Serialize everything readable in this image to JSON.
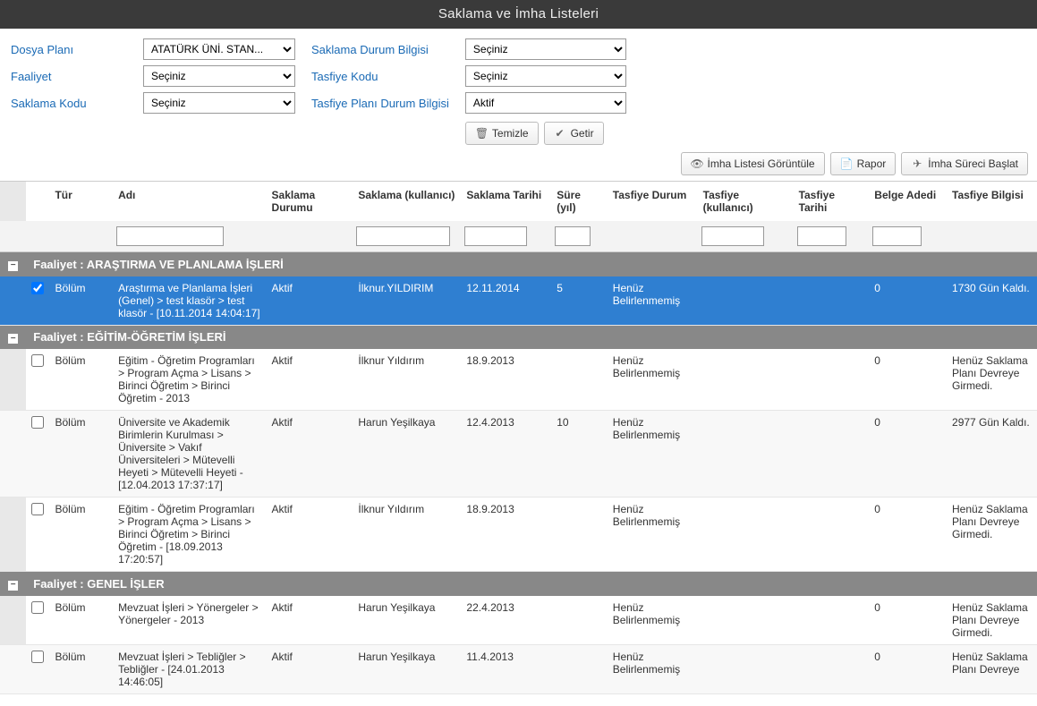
{
  "title": "Saklama ve İmha Listeleri",
  "filters": {
    "dosyaPlani": {
      "label": "Dosya Planı",
      "selected": "ATATÜRK ÜNİ. STAN..."
    },
    "faaliyet": {
      "label": "Faaliyet",
      "selected": "Seçiniz"
    },
    "saklamaKodu": {
      "label": "Saklama Kodu",
      "selected": "Seçiniz"
    },
    "saklamaDurum": {
      "label": "Saklama Durum Bilgisi",
      "selected": "Seçiniz"
    },
    "tasfiyeKodu": {
      "label": "Tasfiye Kodu",
      "selected": "Seçiniz"
    },
    "tasfiyePlanDurum": {
      "label": "Tasfiye Planı Durum Bilgisi",
      "selected": "Aktif"
    },
    "temizle": "Temizle",
    "getir": "Getir"
  },
  "actions": {
    "view": "İmha Listesi Görüntüle",
    "rapor": "Rapor",
    "start": "İmha Süreci Başlat"
  },
  "columns": {
    "tur": "Tür",
    "adi": "Adı",
    "sdurum": "Saklama Durumu",
    "skull": "Saklama (kullanıcı)",
    "starih": "Saklama Tarihi",
    "sure": "Süre (yıl)",
    "tdurum": "Tasfiye Durum",
    "tkull": "Tasfiye (kullanıcı)",
    "ttarih": "Tasfiye Tarihi",
    "adedi": "Belge Adedi",
    "bilgi": "Tasfiye Bilgisi"
  },
  "groups": [
    {
      "title": "Faaliyet : ARAŞTIRMA VE PLANLAMA İŞLERİ",
      "rows": [
        {
          "selected": true,
          "checked": true,
          "tur": "Bölüm",
          "adi": "Araştırma ve Planlama İşleri (Genel) > test klasör > test klasör - [10.11.2014 14:04:17]",
          "sdurum": "Aktif",
          "skull": "İlknur.YILDIRIM",
          "starih": "12.11.2014",
          "sure": "5",
          "tdurum": "Henüz Belirlenmemiş",
          "tkull": "",
          "ttarih": "",
          "adedi": "0",
          "bilgi": "1730 Gün Kaldı."
        }
      ]
    },
    {
      "title": "Faaliyet : EĞİTİM-ÖĞRETİM İŞLERİ",
      "rows": [
        {
          "tur": "Bölüm",
          "adi": "Eğitim - Öğretim Programları > Program Açma > Lisans > Birinci Öğretim > Birinci Öğretim - 2013",
          "sdurum": "Aktif",
          "skull": "İlknur Yıldırım",
          "starih": "18.9.2013",
          "sure": "",
          "tdurum": "Henüz Belirlenmemiş",
          "tkull": "",
          "ttarih": "",
          "adedi": "0",
          "bilgi": "Henüz Saklama Planı Devreye Girmedi."
        },
        {
          "tur": "Bölüm",
          "adi": "Üniversite ve Akademik Birimlerin Kurulması > Üniversite > Vakıf Üniversiteleri > Mütevelli Heyeti > Mütevelli Heyeti - [12.04.2013 17:37:17]",
          "sdurum": "Aktif",
          "skull": "Harun Yeşilkaya",
          "starih": "12.4.2013",
          "sure": "10",
          "tdurum": "Henüz Belirlenmemiş",
          "tkull": "",
          "ttarih": "",
          "adedi": "0",
          "bilgi": "2977 Gün Kaldı."
        },
        {
          "tur": "Bölüm",
          "adi": "Eğitim - Öğretim Programları > Program Açma > Lisans > Birinci Öğretim > Birinci Öğretim - [18.09.2013 17:20:57]",
          "sdurum": "Aktif",
          "skull": "İlknur Yıldırım",
          "starih": "18.9.2013",
          "sure": "",
          "tdurum": "Henüz Belirlenmemiş",
          "tkull": "",
          "ttarih": "",
          "adedi": "0",
          "bilgi": "Henüz Saklama Planı Devreye Girmedi."
        }
      ]
    },
    {
      "title": "Faaliyet : GENEL İŞLER",
      "rows": [
        {
          "tur": "Bölüm",
          "adi": "Mevzuat İşleri > Yönergeler > Yönergeler - 2013",
          "sdurum": "Aktif",
          "skull": "Harun Yeşilkaya",
          "starih": "22.4.2013",
          "sure": "",
          "tdurum": "Henüz Belirlenmemiş",
          "tkull": "",
          "ttarih": "",
          "adedi": "0",
          "bilgi": "Henüz Saklama Planı Devreye Girmedi."
        },
        {
          "tur": "Bölüm",
          "adi": "Mevzuat İşleri > Tebliğler > Tebliğler - [24.01.2013 14:46:05]",
          "sdurum": "Aktif",
          "skull": "Harun Yeşilkaya",
          "starih": "11.4.2013",
          "sure": "",
          "tdurum": "Henüz Belirlenmemiş",
          "tkull": "",
          "ttarih": "",
          "adedi": "0",
          "bilgi": "Henüz Saklama Planı Devreye"
        }
      ]
    }
  ]
}
